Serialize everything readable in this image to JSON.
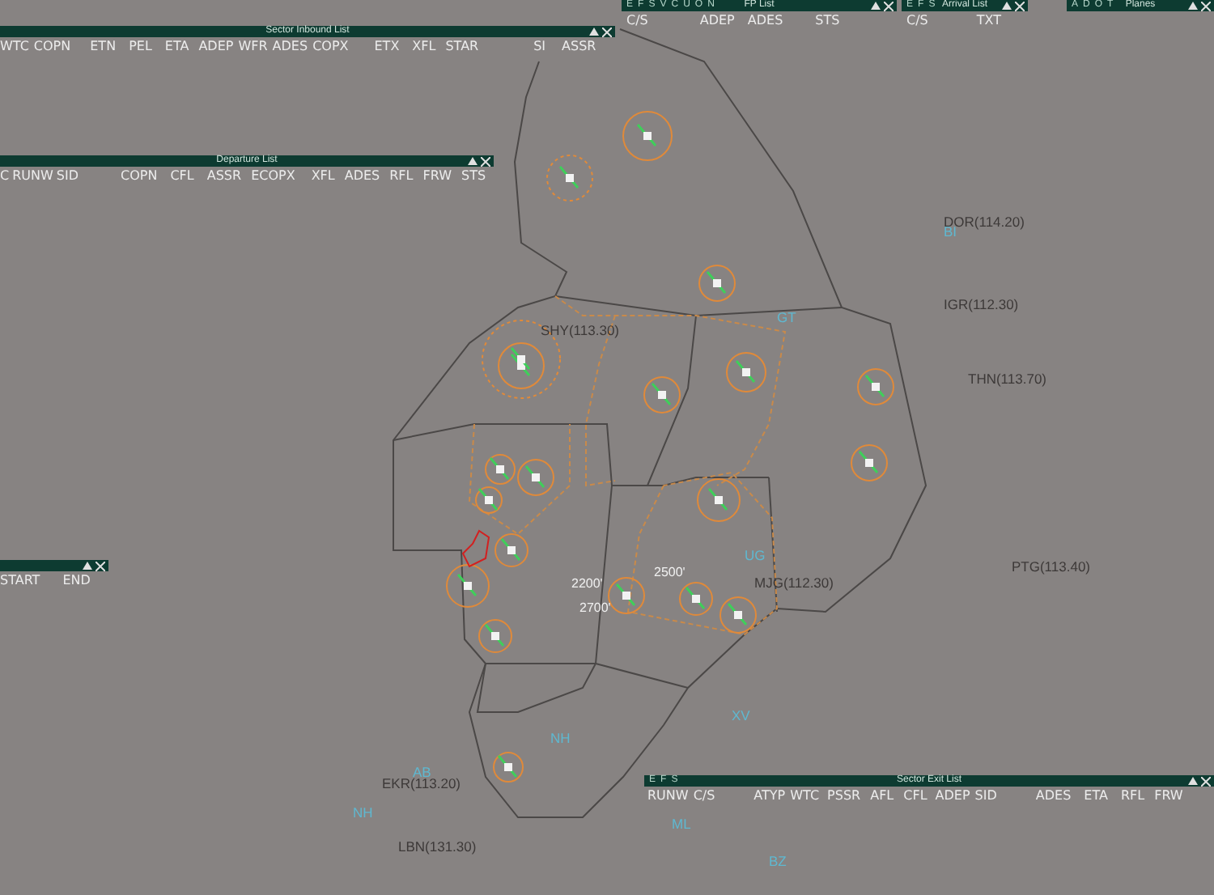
{
  "windows": [
    {
      "title": "Sector Inbound List",
      "columns": [
        "WTC",
        "COPN",
        "ETN",
        "PEL",
        "ETA",
        "ADEP",
        "WFR",
        "ADES",
        "COPX",
        "ETX",
        "XFL",
        "STAR",
        "SI",
        "ASSR"
      ]
    },
    {
      "title": "Departure List",
      "columns": [
        "C",
        "RUNW",
        "SID",
        "COPN",
        "CFL",
        "ASSR",
        "ECOPX",
        "XFL",
        "ADES",
        "RFL",
        "FRW",
        "STS"
      ]
    },
    {
      "title": "FP List",
      "buttons": [
        "E",
        "F",
        "S",
        "V",
        "C",
        "U",
        "O",
        "N"
      ],
      "columns": [
        "C/S",
        "ADEP",
        "ADES",
        "STS"
      ]
    },
    {
      "title": "Arrival List",
      "buttons": [
        "E",
        "F",
        "S"
      ],
      "columns": [
        "C/S",
        "TXT"
      ]
    },
    {
      "title": "Planes",
      "buttons": [
        "A",
        "D",
        "O",
        "T"
      ]
    },
    {
      "columns": [
        "START",
        "END"
      ]
    },
    {
      "title": "Sector Exit List",
      "buttons": [
        "E",
        "F",
        "S"
      ],
      "columns": [
        "RUNW",
        "C/S",
        "ATYP",
        "WTC",
        "PSSR",
        "AFL",
        "CFL",
        "ADEP",
        "SID",
        "ADES",
        "ETA",
        "RFL",
        "FRW"
      ]
    }
  ],
  "map": {
    "navaids": [
      {
        "label": "DOR(114.20)"
      },
      {
        "label": "IGR(112.30)"
      },
      {
        "label": "THN(113.70)"
      },
      {
        "label": "SHY(113.30)"
      },
      {
        "label": "PTG(113.40)"
      },
      {
        "label": "MJG(112.30)"
      },
      {
        "label": "EKR(113.20)"
      },
      {
        "label": "LBN(131.30)"
      }
    ],
    "waypoints": [
      {
        "label": "BI"
      },
      {
        "label": "GT"
      },
      {
        "label": "UG"
      },
      {
        "label": "XV"
      },
      {
        "label": "NH"
      },
      {
        "label": "AB"
      },
      {
        "label": "NH"
      },
      {
        "label": "ML"
      },
      {
        "label": "BZ"
      }
    ],
    "altitude_tags": [
      {
        "label": "2200'"
      },
      {
        "label": "2700'"
      },
      {
        "label": "2500'"
      }
    ]
  }
}
